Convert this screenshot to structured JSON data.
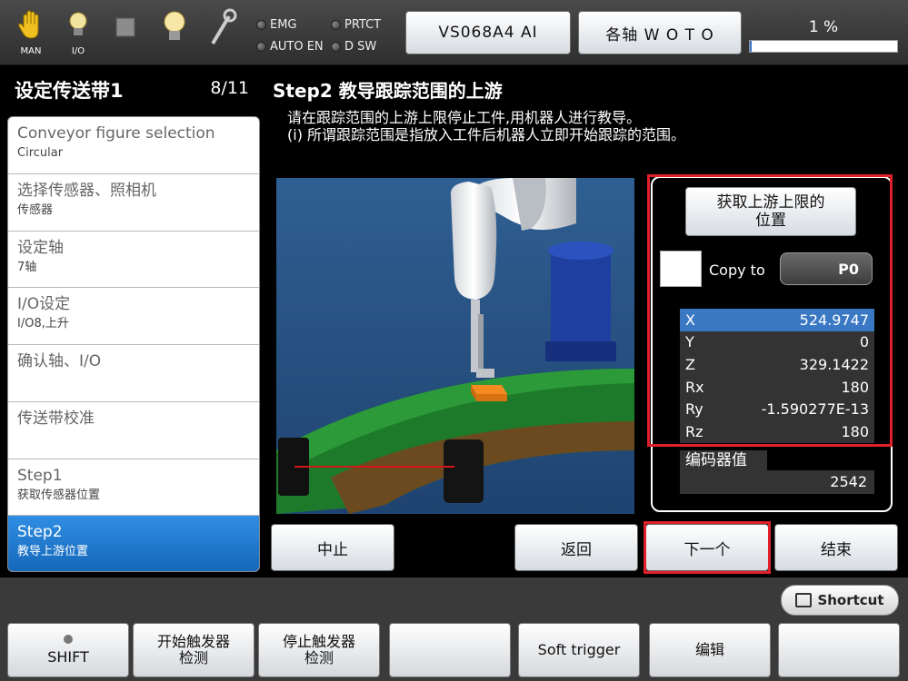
{
  "top": {
    "icons": [
      {
        "icon": "hand-icon",
        "label": "MAN"
      },
      {
        "icon": "bulb-icon",
        "label": "I/O"
      },
      {
        "icon": "stop-square-icon",
        "label": ""
      },
      {
        "icon": "bulb-icon",
        "label": ""
      },
      {
        "icon": "wrench-icon",
        "label": ""
      }
    ],
    "leds": [
      "EMG",
      "PRTCT",
      "AUTO EN",
      "D SW"
    ],
    "robot_button": "VS068A4 AI",
    "axis_button": "各轴  W O T O",
    "speed_text": "1 %",
    "speed_percent": 1
  },
  "wizard": {
    "title": "设定传送带1",
    "page": "8/11",
    "steps": [
      {
        "t1": "Conveyor figure selection",
        "t2": "Circular"
      },
      {
        "t1": "选择传感器、照相机",
        "t2": "传感器"
      },
      {
        "t1": "设定轴",
        "t2": "7轴"
      },
      {
        "t1": "I/O设定",
        "t2": "I/O8,上升"
      },
      {
        "t1": "确认轴、I/O",
        "t2": ""
      },
      {
        "t1": "传送带校准",
        "t2": ""
      },
      {
        "t1": "Step1",
        "t2": "获取传感器位置"
      },
      {
        "t1": "Step2",
        "t2": "教导上游位置"
      }
    ],
    "active_index": 7
  },
  "main": {
    "step_title": "Step2  教导跟踪范围的上游",
    "instruction_1": "请在跟踪范围的上游上限停止工件,用机器人进行教导。",
    "instruction_2": "(i) 所谓跟踪范围是指放入工件后机器人立即开始跟踪的范围。",
    "get_button": "获取上游上限的\n位置",
    "copy_label": "Copy to",
    "copy_target": "P0",
    "coords": [
      {
        "name": "X",
        "value": "524.9747"
      },
      {
        "name": "Y",
        "value": "0"
      },
      {
        "name": "Z",
        "value": "329.1422"
      },
      {
        "name": "Rx",
        "value": "180"
      },
      {
        "name": "Ry",
        "value": "-1.590277E-13"
      },
      {
        "name": "Rz",
        "value": "180"
      }
    ],
    "encoder_label": "编码器值",
    "encoder_value": "2542",
    "buttons": {
      "abort": "中止",
      "back": "返回",
      "next": "下一个",
      "finish": "结束"
    }
  },
  "bottom": {
    "shortcut": "Shortcut",
    "fkeys": [
      "SHIFT",
      "开始触发器\n检测",
      "停止触发器\n检测",
      "",
      "Soft trigger",
      "编辑",
      ""
    ]
  },
  "colors": {
    "accent_blue": "#1a6fc4",
    "highlight_red": "#e0202a",
    "coord_select": "#3a78c4"
  }
}
